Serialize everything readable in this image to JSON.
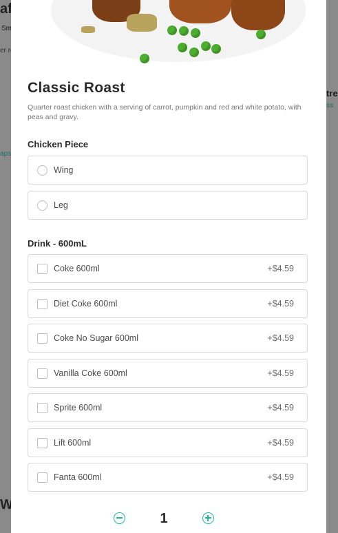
{
  "background": {
    "left_texts": [
      "afi",
      "Sm",
      "er ro",
      "aps",
      "Wr"
    ],
    "right_texts": [
      "tre",
      "ss"
    ]
  },
  "item": {
    "title": "Classic Roast",
    "description": "Quarter roast chicken with a serving of carrot, pumpkin and red and white potato, with peas and gravy."
  },
  "chicken_piece": {
    "heading": "Chicken Piece",
    "options": [
      {
        "label": "Wing"
      },
      {
        "label": "Leg"
      }
    ]
  },
  "drink": {
    "heading": "Drink - 600mL",
    "options": [
      {
        "label": "Coke 600ml",
        "price": "+$4.59"
      },
      {
        "label": "Diet Coke 600ml",
        "price": "+$4.59"
      },
      {
        "label": "Coke No Sugar 600ml",
        "price": "+$4.59"
      },
      {
        "label": "Vanilla Coke 600ml",
        "price": "+$4.59"
      },
      {
        "label": "Sprite 600ml",
        "price": "+$4.59"
      },
      {
        "label": "Lift 600ml",
        "price": "+$4.59"
      },
      {
        "label": "Fanta 600ml",
        "price": "+$4.59"
      }
    ]
  },
  "quantity": {
    "value": "1"
  },
  "colors": {
    "accent": "#19b6a8",
    "overlay": "#7b7b7b"
  }
}
